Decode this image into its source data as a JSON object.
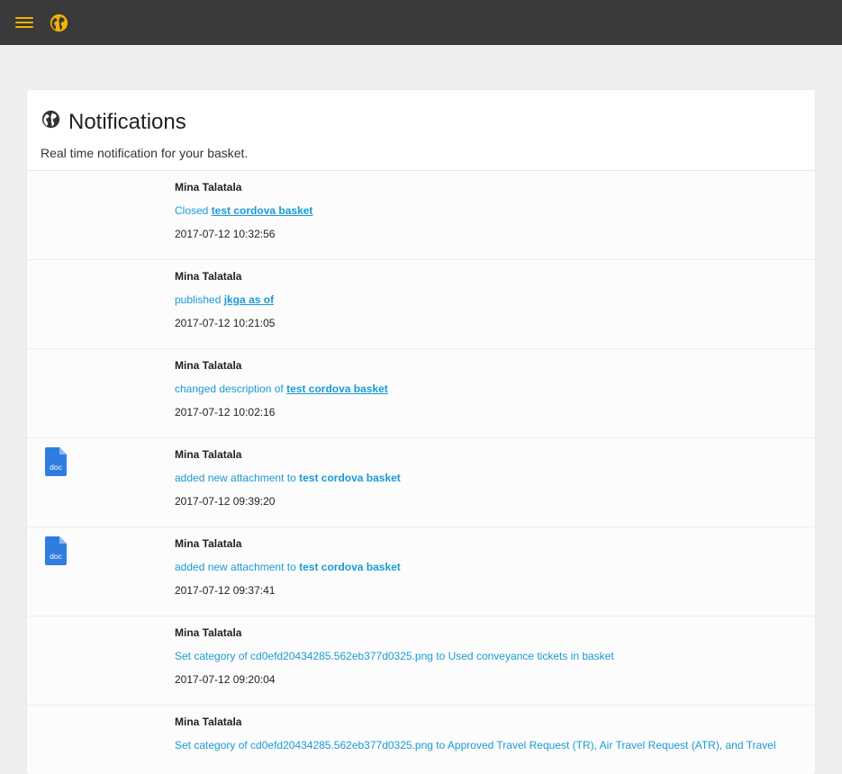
{
  "colors": {
    "accent": "#f5b301",
    "topbar": "#3a3a3a",
    "link": "#1a9ad6",
    "doc_icon": "#2f7de1"
  },
  "topbar": {
    "menu_icon": "hamburger-icon",
    "globe_icon": "globe-icon"
  },
  "header": {
    "icon": "globe-icon",
    "title": "Notifications",
    "subtitle": "Real time notification for your basket."
  },
  "notifications": [
    {
      "user": "Mina Talatala",
      "action": "Closed ",
      "target": "test cordova basket",
      "time": "2017-07-12 10:32:56",
      "icon": ""
    },
    {
      "user": "Mina Talatala",
      "action": "published ",
      "target": "jkga as of",
      "time": "2017-07-12 10:21:05",
      "icon": ""
    },
    {
      "user": "Mina Talatala",
      "action": "changed description of ",
      "target": "test cordova basket",
      "time": "2017-07-12 10:02:16",
      "icon": ""
    },
    {
      "user": "Mina Talatala",
      "action": "added new attachment to ",
      "target": "test cordova basket",
      "time": "2017-07-12 09:39:20",
      "icon": "doc",
      "icon_name": "doc-file-icon"
    },
    {
      "user": "Mina Talatala",
      "action": "added new attachment to ",
      "target": "test cordova basket",
      "time": "2017-07-12 09:37:41",
      "icon": "doc",
      "icon_name": "doc-file-icon"
    },
    {
      "user": "Mina Talatala",
      "action": "Set category of cd0efd20434285.562eb377d0325.png to Used conveyance tickets in basket",
      "target": "",
      "time": "2017-07-12 09:20:04",
      "icon": ""
    },
    {
      "user": "Mina Talatala",
      "action": "Set category of cd0efd20434285.562eb377d0325.png to Approved Travel Request (TR), Air Travel Request (ATR), and Travel",
      "target": "",
      "time": "",
      "icon": ""
    }
  ]
}
